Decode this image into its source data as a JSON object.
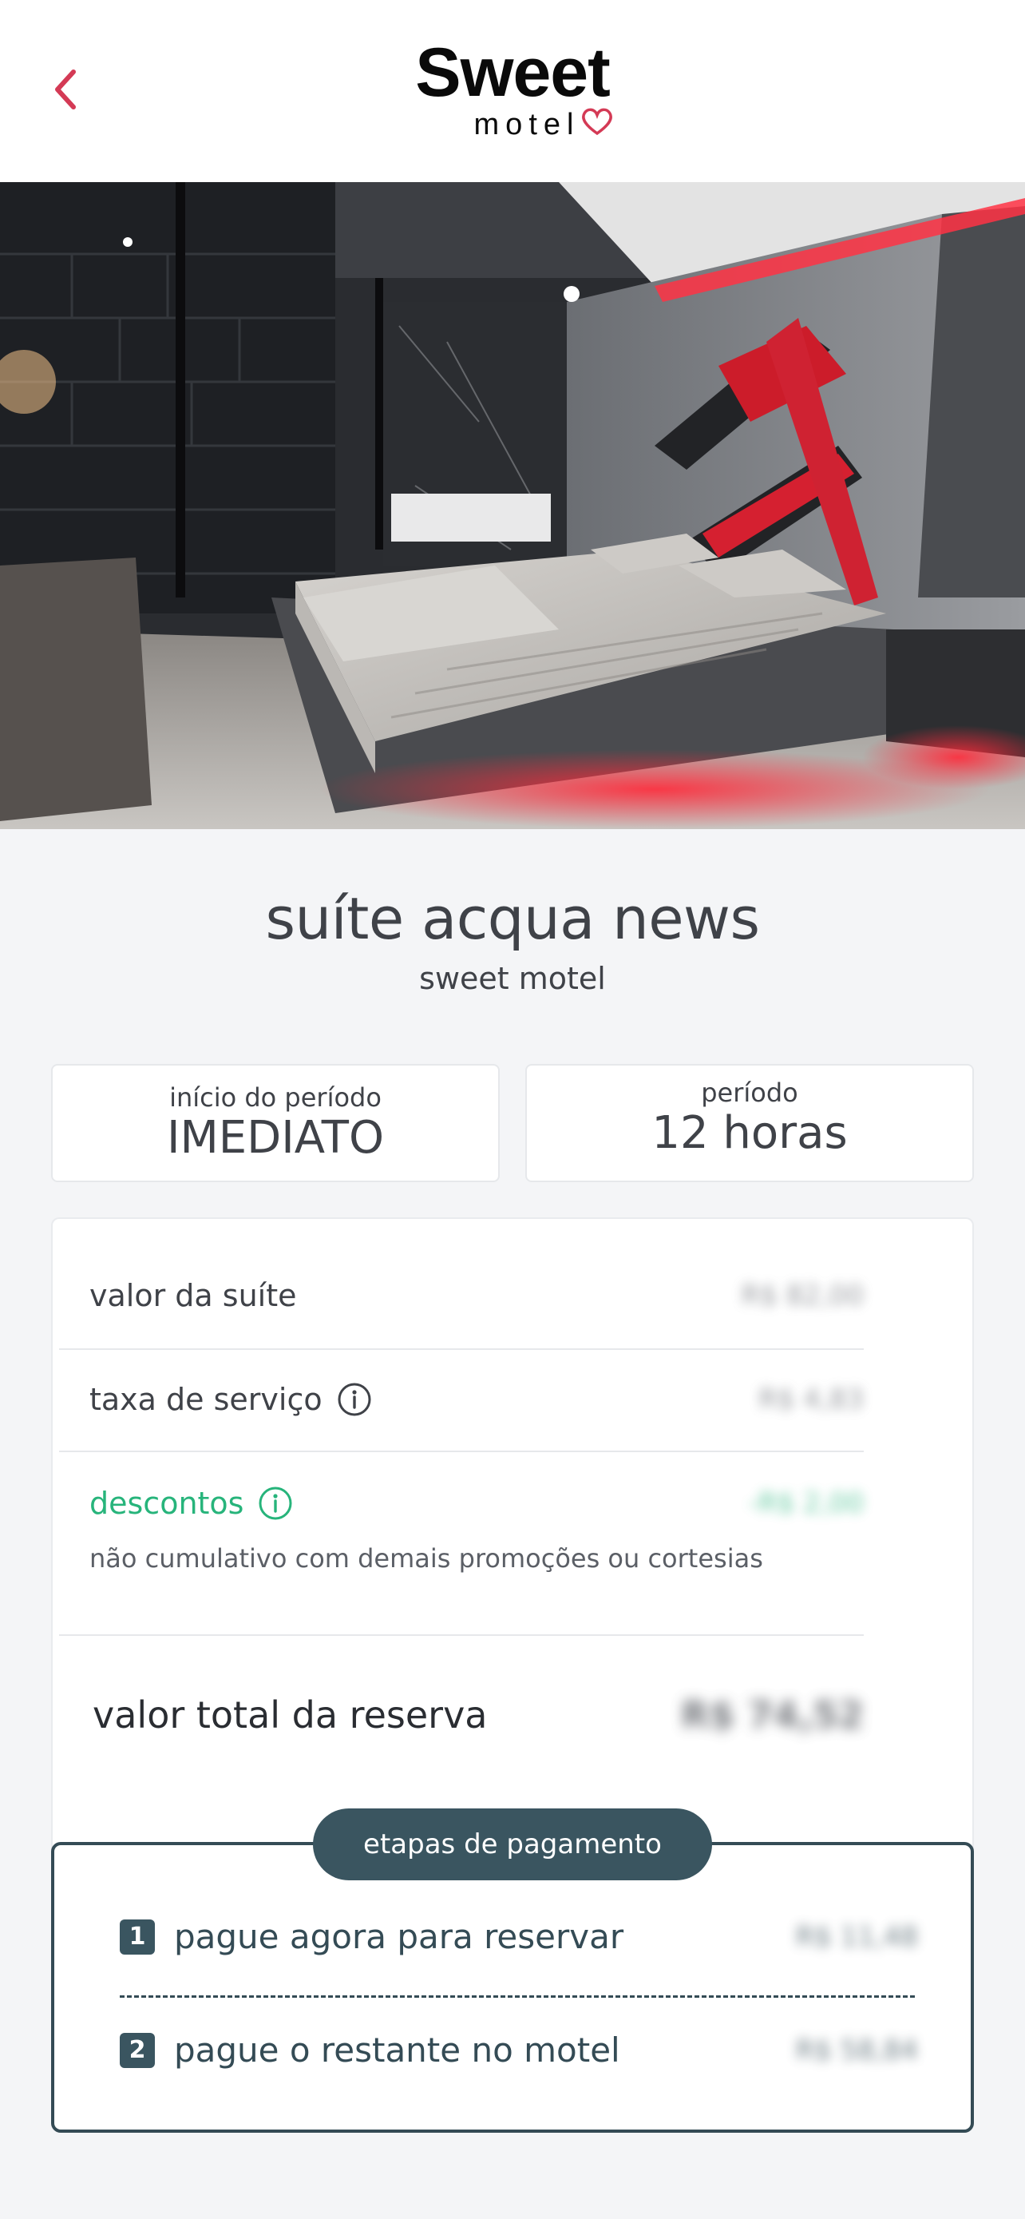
{
  "header": {
    "back_icon": "chevron-left-icon",
    "logo_main": "Sweet",
    "logo_sub": "motel",
    "accent_color": "#d43a55"
  },
  "gallery": {
    "total_images": 12,
    "active_index": 0
  },
  "suite": {
    "title": "suíte acqua news",
    "motel_name": "sweet motel"
  },
  "period": {
    "start_label": "início do período",
    "start_value": "IMEDIATO",
    "duration_label": "período",
    "duration_value": "12 horas"
  },
  "pricing": {
    "suite_value_label": "valor da suíte",
    "suite_value": "R$ 82,00",
    "service_fee_label": "taxa de serviço",
    "service_fee_value": "R$ 4,83",
    "discounts_label": "descontos",
    "discounts_value": "-R$ 2,00",
    "discounts_note": "não cumulativo com demais promoções ou cortesias",
    "total_label": "valor total da reserva",
    "total_value": "R$ 74,52",
    "discount_color": "#27b47b"
  },
  "payment": {
    "title": "etapas de pagamento",
    "steps": [
      {
        "num": "1",
        "label": "pague agora para reservar",
        "value": "R$ 11,48"
      },
      {
        "num": "2",
        "label": "pague o restante no motel",
        "value": "R$ 58,84"
      }
    ],
    "color": "#3a5560"
  }
}
